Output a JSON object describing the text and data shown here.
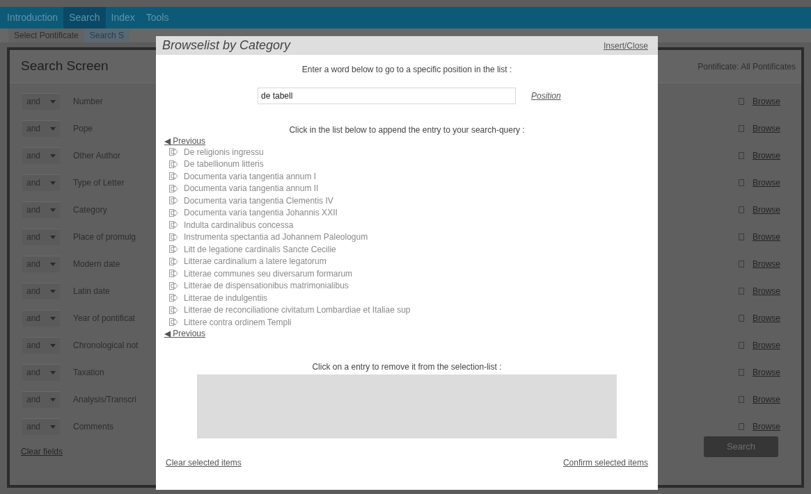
{
  "nav": {
    "items": [
      {
        "label": "Introduction",
        "selected": false
      },
      {
        "label": "Search",
        "selected": true
      },
      {
        "label": "Index",
        "selected": false
      },
      {
        "label": "Tools",
        "selected": false
      }
    ]
  },
  "subtabs": [
    {
      "label": "Select Pontificate",
      "selected": false
    },
    {
      "label": "Search S",
      "selected": true
    }
  ],
  "search_screen": {
    "title": "Search Screen",
    "pontificate": "Pontificate: All Pontificates",
    "rows": [
      {
        "operator": "and",
        "label": "Number",
        "browse": "Browse"
      },
      {
        "operator": "and",
        "label": "Pope",
        "browse": "Browse"
      },
      {
        "operator": "and",
        "label": "Other Author",
        "browse": "Browse"
      },
      {
        "operator": "and",
        "label": "Type of Letter",
        "browse": "Browse"
      },
      {
        "operator": "and",
        "label": "Category",
        "browse": "Browse"
      },
      {
        "operator": "and",
        "label": "Place of promulg",
        "browse": "Browse"
      },
      {
        "operator": "and",
        "label": "Modern date",
        "browse": "Browse"
      },
      {
        "operator": "and",
        "label": "Latin date",
        "browse": "Browse"
      },
      {
        "operator": "and",
        "label": "Year of pontificat",
        "browse": "Browse"
      },
      {
        "operator": "and",
        "label": "Chronological not",
        "browse": "Browse"
      },
      {
        "operator": "and",
        "label": "Taxation",
        "browse": "Browse"
      },
      {
        "operator": "and",
        "label": "Analysis/Transcri",
        "browse": "Browse"
      },
      {
        "operator": "and",
        "label": "Comments",
        "browse": "Browse"
      }
    ],
    "clear_link": "Clear fields",
    "search_button": "Search"
  },
  "dialog": {
    "title": "Browselist by Category",
    "close_link": "Insert/Close",
    "position_hint": "Enter a word below to go to a specific position in the list :",
    "position_value": "de tabell",
    "position_link": "Position",
    "list_hint": "Click in the list below to append the entry to your search-query :",
    "previous_top": "◀ Previous",
    "entries": [
      "De religionis ingressu",
      "De tabellionum litteris",
      "Documenta varia tangentia annum I",
      "Documenta varia tangentia annum II",
      "Documenta varia tangentia Clementis IV",
      "Documenta varia tangentia Johannis XXII",
      "Indulta cardinalibus concessa",
      "Instrumenta spectantia ad Johannem Paleologum",
      "Litt de legatione cardinalis Sancte Cecilie",
      "Litterae cardinalium a latere legatorum",
      "Litterae communes seu diversarum formarum",
      "Litterae de dispensationibus matrimonialibus",
      "Litterae de indulgentiis",
      "Litterae de reconciliatione civitatum Lombardiae et Italiae sup",
      "Littere contra ordinem Templi"
    ],
    "previous_bottom": "◀ Previous",
    "selection_hint": "Click on a entry to remove it from the selection-list :",
    "clear_selected": "Clear selected items",
    "confirm_selected": "Confirm selected items"
  }
}
